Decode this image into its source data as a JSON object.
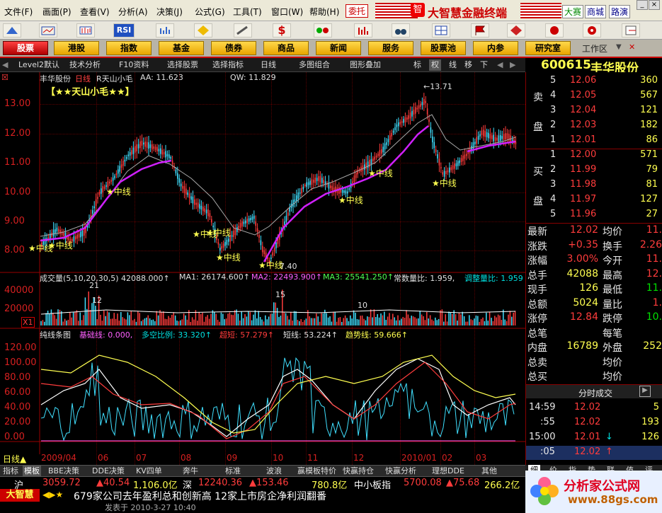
{
  "menu": {
    "items": [
      "文件(F)",
      "画面(P)",
      "查看(V)",
      "分析(A)",
      "决策(J)",
      "公式(G)",
      "工具(T)",
      "窗口(W)",
      "帮助(H)"
    ],
    "wt": "委托",
    "brand": "大智慧金融终端",
    "right_items": [
      "大赛",
      "商城",
      "路演"
    ]
  },
  "nav": {
    "items": [
      "股票",
      "港股",
      "指数",
      "基金",
      "债券",
      "商品",
      "新闻",
      "服务",
      "股票池",
      "内参",
      "研究室"
    ],
    "workspace": "工作区"
  },
  "tabs": {
    "items": [
      "Level2默认",
      "技术分析",
      "F10资料",
      "选择股票",
      "选择指标",
      "日线",
      "多图组合",
      "图形叠加",
      "标",
      "权",
      "线",
      "移",
      "下"
    ]
  },
  "stock": {
    "code": "600615",
    "name": "丰华股份"
  },
  "main": {
    "title": "丰华股份",
    "period": "日线",
    "formula": "R天山小毛",
    "aa": "AA: 11.623",
    "qw": "QW: 11.829",
    "banner": "【★★天山小毛★★】",
    "high_label": "13.71",
    "low_label": "7.40",
    "marker_label": "中线",
    "y_labels": [
      "13.00",
      "12.00",
      "11.00",
      "10.00",
      "9.00",
      "8.00"
    ]
  },
  "vol": {
    "header": "成交量(5,10,20,30,5) 42088.000↑",
    "ma1": "MA1: 26174.600↑",
    "ma2": "MA2: 22493.900↑",
    "ma3": "MA3: 25541.250↑",
    "ratio": "常数量比: 1.959,",
    "ratio2": "调整量比: 1.959",
    "y_labels": [
      "40000",
      "20000"
    ],
    "unit": "X1",
    "peaks": [
      "21",
      "12",
      "15",
      "10"
    ]
  },
  "osc": {
    "header": "纯线条图",
    "base": "基础线: 0.000,",
    "ratio": "多空比例: 33.320↑",
    "ultra": "超短: 57.279↑",
    "short": "短线: 53.224↑",
    "trend": "趋势线: 59.666↑",
    "y_labels": [
      "120.00",
      "100.00",
      "80.00",
      "60.00",
      "40.00",
      "20.00",
      "0.00"
    ]
  },
  "xaxis": {
    "labels": [
      "2009/04",
      "06",
      "07",
      "08",
      "09",
      "10",
      "11",
      "12",
      "2010/01",
      "02",
      "03"
    ],
    "period_tag": "日线"
  },
  "orderbook": {
    "sell_label": [
      "卖",
      "盘"
    ],
    "buy_label": [
      "买",
      "盘"
    ],
    "sell": [
      [
        "5",
        "12.06",
        "360"
      ],
      [
        "4",
        "12.05",
        "567"
      ],
      [
        "3",
        "12.04",
        "121"
      ],
      [
        "2",
        "12.03",
        "182"
      ],
      [
        "1",
        "12.01",
        "86"
      ]
    ],
    "buy": [
      [
        "1",
        "12.00",
        "571"
      ],
      [
        "2",
        "11.99",
        "79"
      ],
      [
        "3",
        "11.98",
        "81"
      ],
      [
        "4",
        "11.97",
        "127"
      ],
      [
        "5",
        "11.96",
        "27"
      ]
    ]
  },
  "quote": [
    [
      "最新",
      "12.02",
      "均价",
      "11."
    ],
    [
      "涨跌",
      "+0.35",
      "换手",
      "2.26"
    ],
    [
      "涨幅",
      "3.00%",
      "今开",
      "11."
    ],
    [
      "总手",
      "42088",
      "最高",
      "12."
    ],
    [
      "现手",
      "126",
      "最低",
      "11."
    ],
    [
      "总额",
      "5024",
      "量比",
      "1."
    ],
    [
      "涨停",
      "12.84",
      "跌停",
      "10."
    ],
    [
      "总笔",
      "",
      "每笔",
      ""
    ],
    [
      "内盘",
      "16789",
      "外盘",
      "252"
    ],
    [
      "总卖",
      "",
      "均价",
      ""
    ],
    [
      "总买",
      "",
      "均价",
      ""
    ]
  ],
  "ticks": {
    "title": "分时成交",
    "rows": [
      [
        "14:59",
        "12.02",
        "5"
      ],
      [
        ":55",
        "12.02",
        "193"
      ],
      [
        "15:00",
        "12.01",
        "126"
      ],
      [
        ":05",
        "12.02",
        ""
      ]
    ]
  },
  "bottom_tabs": [
    "指标",
    "模板",
    "BBE决策",
    "DDE决策",
    "KV四单",
    "奔牛",
    "标准",
    "波浪",
    "赢模板特价",
    "快赢持仓",
    "快赢分析",
    "理想DDE",
    "其他"
  ],
  "side_tabs": [
    "细",
    "价",
    "指",
    "势",
    "联",
    "值",
    "评"
  ],
  "ticker": {
    "sh_label": "沪",
    "sh": "3059.72",
    "sh_chg": "40.54",
    "sh_amt": "1,106.0亿",
    "sz_label": "深",
    "sz": "12240.36",
    "sz_chg": "153.46",
    "sz_amt": "780.8亿",
    "mid_label": "中小板指",
    "mid": "5700.08",
    "mid_chg": "75.68",
    "mid_amt": "266.2亿"
  },
  "news": {
    "brand": "大智慧",
    "text": "679家公司去年盈利总和创新高 12家上市房企净利润翻番",
    "time": "发表于 2010-3-27 10:40"
  },
  "logo": {
    "text": "分析家公式网",
    "url": "www.88gs.com"
  },
  "colors": {
    "up": "#ff3c3c",
    "ma_main": "#d020ff",
    "ma_thin": "#b0b0b0",
    "yellow": "#ffff50",
    "cyan": "#00e0e0"
  }
}
